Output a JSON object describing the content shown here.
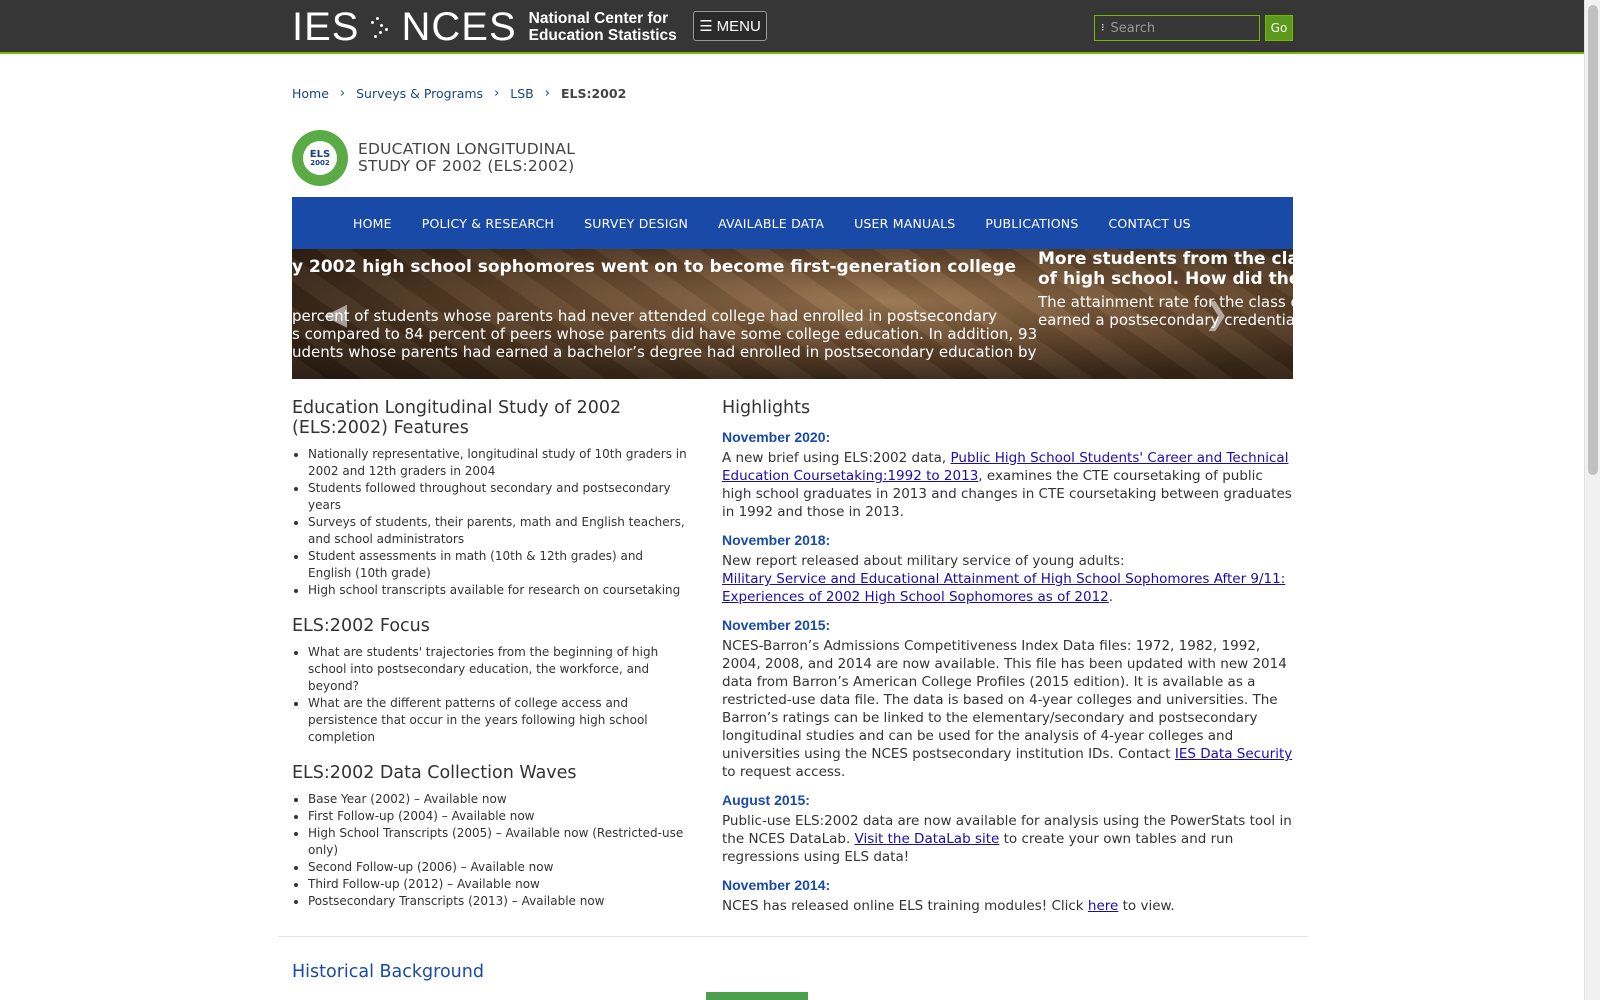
{
  "header": {
    "logo_ies": "IES",
    "logo_nces": "NCES",
    "logo_sub_line1": "National Center for",
    "logo_sub_line2": "Education Statistics",
    "menu_label": "MENU",
    "search_placeholder": "Search",
    "go_label": "Go"
  },
  "breadcrumb": {
    "items": [
      "Home",
      "Surveys & Programs",
      "LSB"
    ],
    "current": "ELS:2002"
  },
  "study": {
    "logo_line1": "ELS",
    "logo_line2": "2002",
    "title_line1": "EDUCATION LONGITUDINAL",
    "title_line2": "STUDY OF 2002 (ELS:2002)"
  },
  "nav": {
    "items": [
      "HOME",
      "POLICY & RESEARCH",
      "SURVEY DESIGN",
      "AVAILABLE DATA",
      "USER MANUALS",
      "PUBLICATIONS",
      "CONTACT US"
    ]
  },
  "carousel": {
    "slide_a_title": "y 2002 high school sophomores went on to become first-generation college",
    "slide_a_lines": [
      " percent of students whose parents had never attended college had enrolled in postsecondary",
      "s compared to 84 percent of peers whose parents did have some college education. In addition, 93",
      "udents whose parents had earned a bachelor’s degree had enrolled in postsecondary education by"
    ],
    "slide_b_title_lines": [
      "More students from the class",
      "of high school. How did the a"
    ],
    "slide_b_lines": [
      "The attainment rate for the class o",
      "earned a postsecondary credential"
    ]
  },
  "features": {
    "title": "Education Longitudinal Study of 2002 (ELS:2002) Features",
    "items": [
      "Nationally representative, longitudinal study of 10th graders in 2002 and 12th graders in 2004",
      "Students followed throughout secondary and postsecondary years",
      "Surveys of students, their parents, math and English teachers, and school administrators",
      "Student assessments in math (10th & 12th grades) and English (10th grade)",
      "High school transcripts available for research on coursetaking"
    ]
  },
  "focus": {
    "title": "ELS:2002 Focus",
    "items": [
      "What are students' trajectories from the beginning of high school into postsecondary education, the workforce, and beyond?",
      "What are the different patterns of college access and persistence that occur in the years following high school completion"
    ]
  },
  "waves": {
    "title": "ELS:2002 Data Collection Waves",
    "items": [
      "Base Year (2002) – Available now",
      "First Follow-up (2004) – Available now",
      "High School Transcripts (2005) – Available now (Restricted-use only)",
      "Second Follow-up (2006) – Available now",
      "Third Follow-up (2012) – Available now",
      "Postsecondary Transcripts (2013) – Available now"
    ]
  },
  "highlights": {
    "title": "Highlights",
    "h1_date": "November 2020:",
    "h1_pre": "A new brief using ELS:2002 data, ",
    "h1_link": "Public High School Students' Career and Technical Education Coursetaking:1992 to 2013",
    "h1_post": ", examines the CTE coursetaking of public high school graduates in 2013 and changes in CTE coursetaking between graduates in 1992 and those in 2013.",
    "h2_date": "November 2018:",
    "h2_pre": "New report released about military service of young adults: ",
    "h2_link": "Military Service and Educational Attainment of High School Sophomores After 9/11: Experiences of 2002 High School Sophomores as of 2012",
    "h2_post": ".",
    "h3_date": "November 2015:",
    "h3_pre": "NCES-Barron’s Admissions Competitiveness Index Data files: 1972, 1982, 1992, 2004, 2008, and 2014 are now available. This file has been updated with new 2014 data from Barron’s American College Profiles (2015 edition). It is available as a restricted-use data file. The data is based on 4-year colleges and universities. The Barron’s ratings can be linked to the elementary/secondary and postsecondary longitudinal studies and can be used for the analysis of 4-year colleges and universities using the NCES postsecondary institution IDs. Contact ",
    "h3_link": "IES Data Security",
    "h3_post": " to request access.",
    "h4_date": "August 2015:",
    "h4_pre": "Public-use ELS:2002 data are now available for analysis using the PowerStats tool in the NCES DataLab. ",
    "h4_link": "Visit the DataLab site",
    "h4_post": " to create your own tables and run regressions using ELS data!",
    "h5_date": "November 2014:",
    "h5_pre": "NCES has released online ELS training modules! Click ",
    "h5_link": "here",
    "h5_post": " to view."
  },
  "historical": {
    "title": "Historical Background"
  },
  "colors": {
    "topbar": "#363636",
    "accent_green": "#7ab800",
    "nav_blue": "#1a4aa8"
  }
}
